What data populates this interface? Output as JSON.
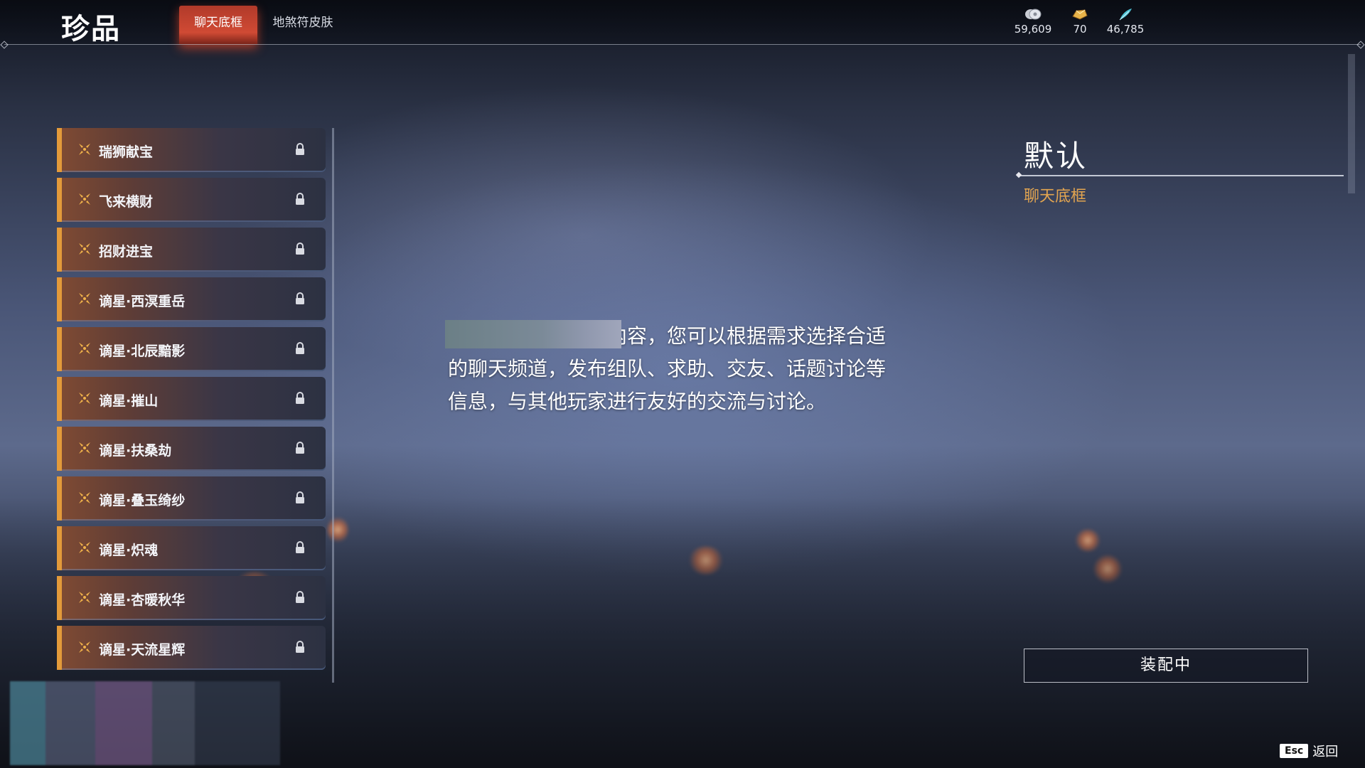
{
  "header": {
    "title": "珍品",
    "tabs": [
      {
        "label": "聊天底框",
        "active": true
      },
      {
        "label": "地煞符皮肤",
        "active": false
      }
    ],
    "currencies": [
      {
        "icon": "silver-coin-icon",
        "value": "59,609"
      },
      {
        "icon": "gold-ingot-icon",
        "value": "70"
      },
      {
        "icon": "jade-feather-icon",
        "value": "46,785"
      }
    ]
  },
  "list": {
    "items": [
      {
        "label": "瑞狮献宝",
        "locked": true
      },
      {
        "label": "飞来横财",
        "locked": true
      },
      {
        "label": "招财进宝",
        "locked": true
      },
      {
        "label": "谪星·西溟重岳",
        "locked": true
      },
      {
        "label": "谪星·北辰黯影",
        "locked": true
      },
      {
        "label": "谪星·摧山",
        "locked": true
      },
      {
        "label": "谪星·扶桑劫",
        "locked": true
      },
      {
        "label": "谪星·叠玉绮纱",
        "locked": true
      },
      {
        "label": "谪星·炽魂",
        "locked": true
      },
      {
        "label": "谪星·杏暖秋华",
        "locked": true
      },
      {
        "label": "谪星·天流星辉",
        "locked": true
      }
    ]
  },
  "preview": {
    "description": "显示的是您的聊天内容，您可以根据需求选择合适的聊天频道，发布组队、求助、交友、话题讨论等信息，与其他玩家进行友好的交流与讨论。"
  },
  "detail": {
    "name": "默认",
    "category": "聊天底框",
    "equip_label": "装配中"
  },
  "footer": {
    "esc_key": "Esc",
    "back_label": "返回"
  },
  "colors": {
    "accent_orange": "#e39a3a",
    "tab_red": "#d04a34",
    "category_gold": "#e3a550"
  }
}
